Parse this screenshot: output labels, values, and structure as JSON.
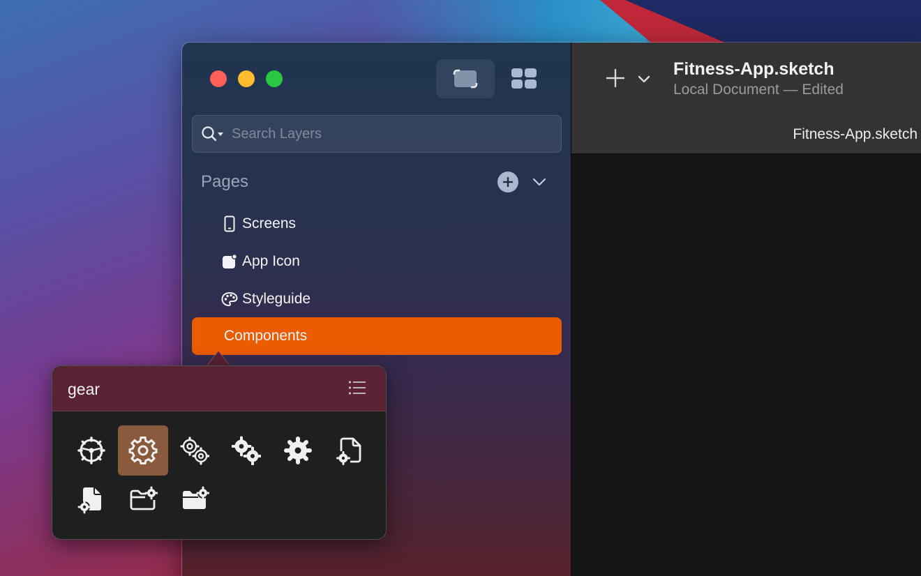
{
  "window": {
    "search": {
      "placeholder": "Search Layers"
    },
    "pages": {
      "header": "Pages",
      "items": [
        {
          "label": "Screens",
          "icon": "phone-icon"
        },
        {
          "label": "App Icon",
          "icon": "app-icon-icon"
        },
        {
          "label": "Styleguide",
          "icon": "palette-icon"
        },
        {
          "label": "Components",
          "icon": "",
          "selected": true
        }
      ]
    },
    "document": {
      "title": "Fitness-App.sketch",
      "subtitle": "Local Document — Edited",
      "tab": "Fitness-App.sketch"
    }
  },
  "popover": {
    "query": "gear",
    "icons": [
      "gear-steering-icon",
      "gear-icon",
      "gears-outline-icon",
      "gears-filled-icon",
      "gear-filled-icon",
      "document-gear-outline-icon",
      "document-gear-filled-icon",
      "folder-gear-outline-icon",
      "folder-gear-filled-icon"
    ],
    "selected_index": 1
  },
  "colors": {
    "accent": "#eb5b00",
    "selection_icon_bg": "#8a5a3c",
    "traffic_red": "#ff5f57",
    "traffic_yellow": "#febc2e",
    "traffic_green": "#28c840"
  }
}
